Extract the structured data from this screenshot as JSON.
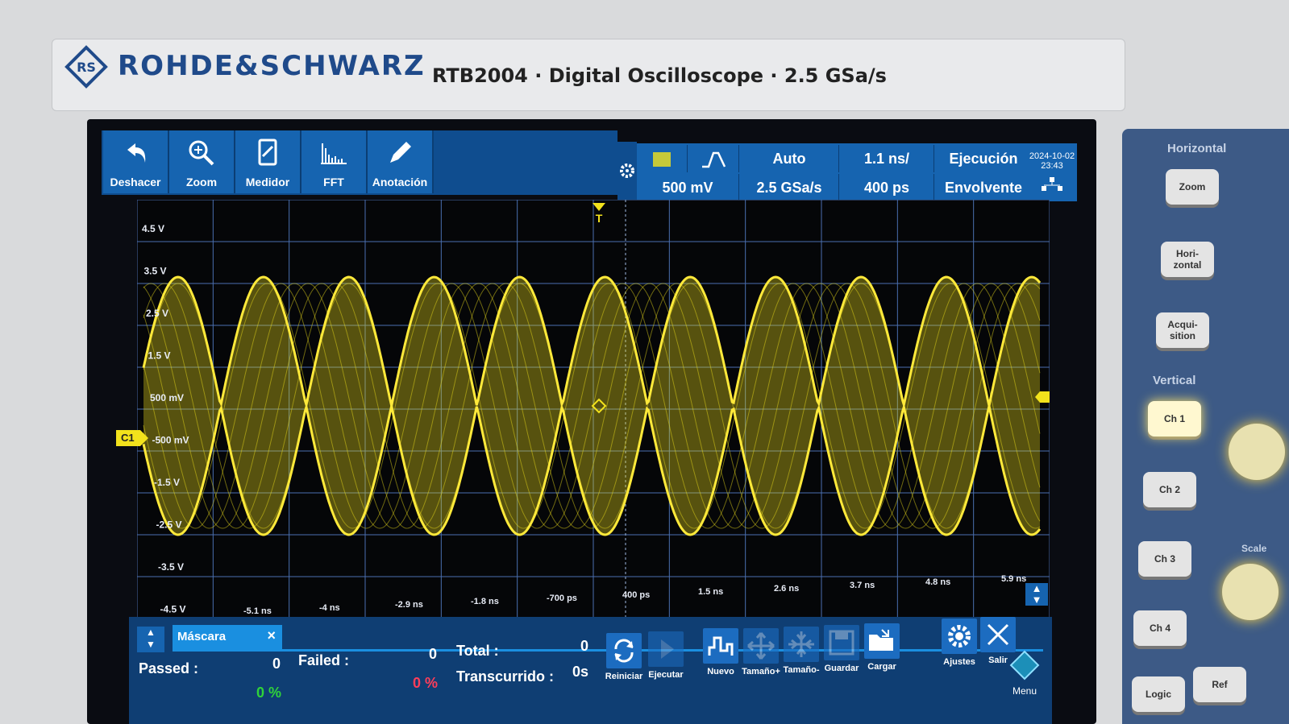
{
  "device": {
    "brand": "ROHDE&SCHWARZ",
    "model_line": "RTB2004 · Digital Oscilloscope · 2.5 GSa/s"
  },
  "toolbar": {
    "items": [
      {
        "label": "Deshacer",
        "icon": "undo-icon"
      },
      {
        "label": "Zoom",
        "icon": "zoom-icon"
      },
      {
        "label": "Medidor",
        "icon": "meter-icon"
      },
      {
        "label": "FFT",
        "icon": "fft-icon"
      },
      {
        "label": "Anotación",
        "icon": "pencil-icon"
      }
    ]
  },
  "status": {
    "trigger_mode": "Auto",
    "channel_scale": "500 mV",
    "sample_rate": "2.5 GSa/s",
    "time_base": "1.1 ns/",
    "time_offset": "400 ps",
    "run_state": "Ejecución",
    "acq_mode": "Envolvente",
    "date": "2024-10-02",
    "time": "23:43",
    "channel_color": "#f2e21c"
  },
  "grid": {
    "voltage_labels": [
      "4.5 V",
      "3.5 V",
      "2.5 V",
      "1.5 V",
      "500 mV",
      "-500 mV",
      "-1.5 V",
      "-2.5 V",
      "-3.5 V",
      "-4.5 V"
    ],
    "time_labels": [
      "-5.1 ns",
      "-4 ns",
      "-2.9 ns",
      "-1.8 ns",
      "-700 ps",
      "400 ps",
      "1.5 ns",
      "2.6 ns",
      "3.7 ns",
      "4.8 ns",
      "5.9 ns"
    ],
    "channel_marker": "C1",
    "trigger_marker": "T"
  },
  "mask": {
    "tab_label": "Máscara",
    "passed_label": "Passed :",
    "passed_value": "0",
    "passed_pct": "0 %",
    "failed_label": "Failed :",
    "failed_value": "0",
    "failed_pct": "0 %",
    "total_label": "Total :",
    "total_value": "0",
    "elapsed_label": "Transcurrido :",
    "elapsed_value": "0s",
    "buttons": [
      {
        "label": "Reiniciar",
        "icon": "refresh-icon"
      },
      {
        "label": "Ejecutar",
        "icon": "play-icon"
      },
      {
        "label": "Nuevo",
        "icon": "new-mask-icon"
      },
      {
        "label": "Tamaño+",
        "icon": "expand-icon"
      },
      {
        "label": "Tamaño-",
        "icon": "shrink-icon"
      },
      {
        "label": "Guardar",
        "icon": "save-icon"
      },
      {
        "label": "Cargar",
        "icon": "folder-open-icon"
      },
      {
        "label": "Ajustes",
        "icon": "gear-icon"
      },
      {
        "label": "Salir",
        "icon": "close-icon"
      }
    ],
    "menu_label": "Menu"
  },
  "side_panel": {
    "horizontal_title": "Horizontal",
    "horizontal_keys": [
      "Zoom",
      "Hori-\nzontal",
      "Acqui-\nsition"
    ],
    "vertical_title": "Vertical",
    "channel_keys": [
      "Ch 1",
      "Ch 2",
      "Ch 3",
      "Ch 4"
    ],
    "scale_label": "Scale",
    "logic_key": "Logic",
    "ref_key": "Ref"
  }
}
